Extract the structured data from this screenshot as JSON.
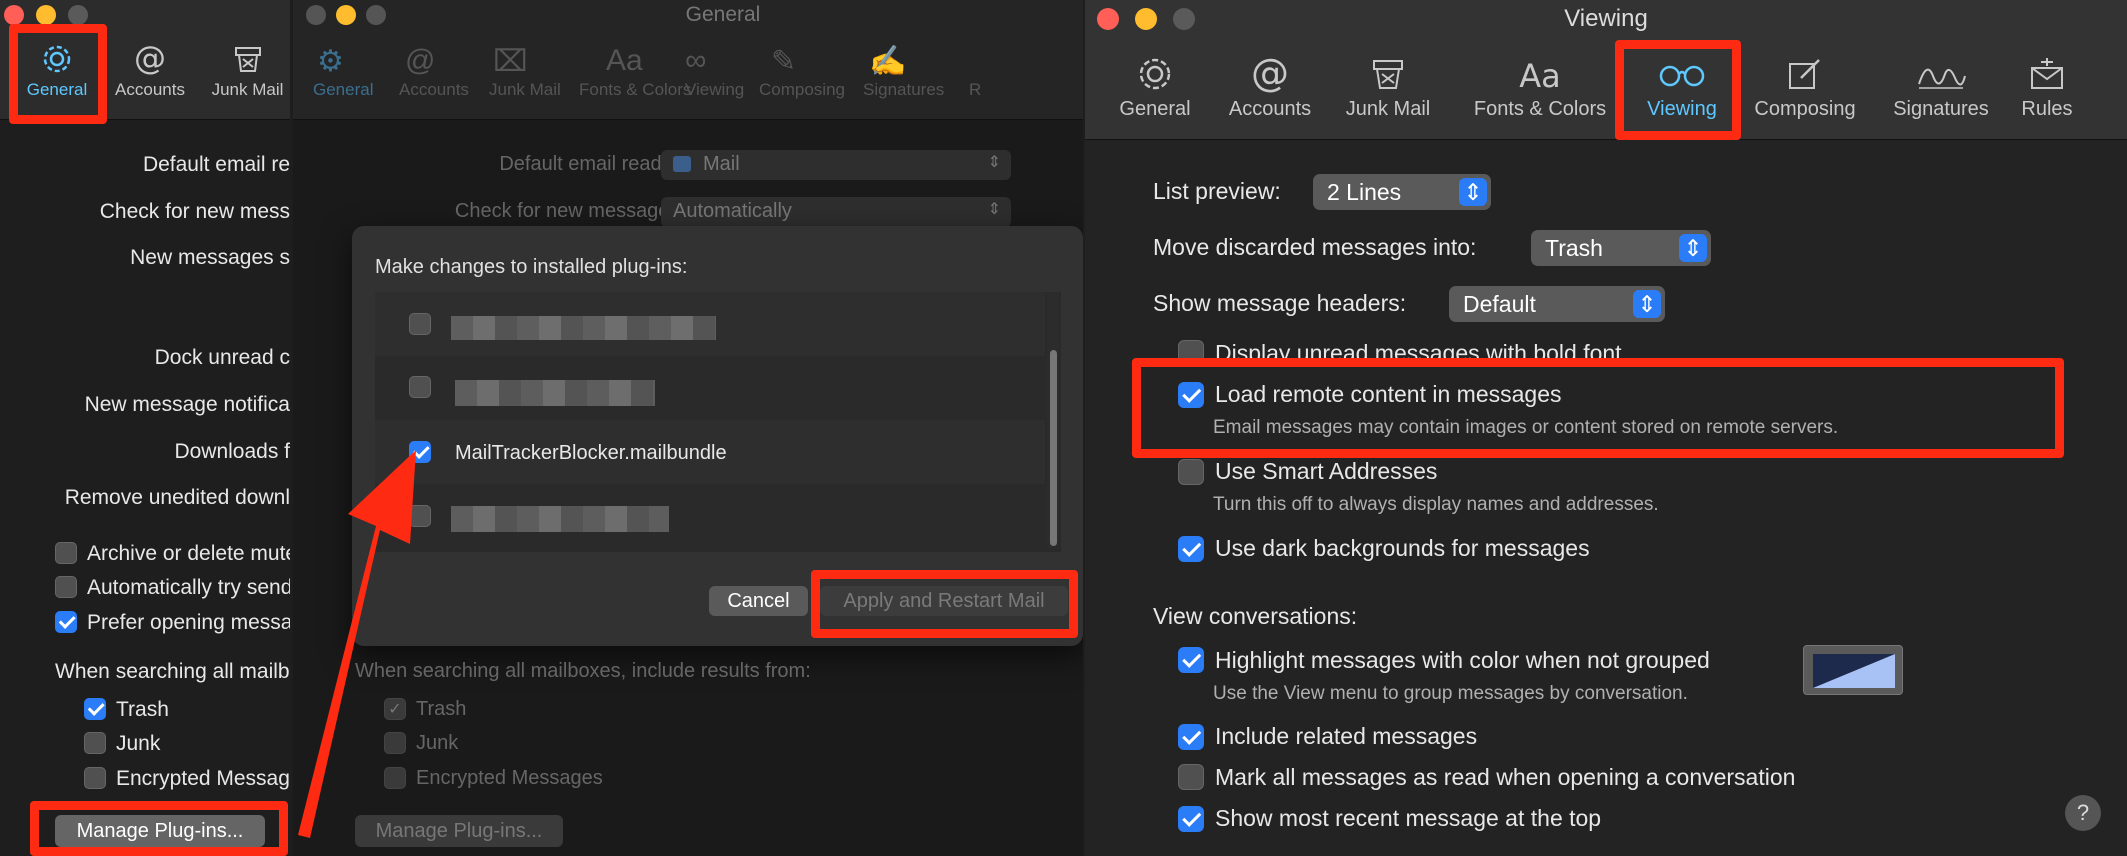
{
  "left": {
    "toolbar": [
      {
        "label": "General",
        "icon": "gear-icon",
        "active": true
      },
      {
        "label": "Accounts",
        "icon": "at-icon"
      },
      {
        "label": "Junk Mail",
        "icon": "junk-icon"
      }
    ],
    "labels": [
      "Default email re",
      "Check for new mess",
      "New messages s",
      "Dock unread c",
      "New message notifica",
      "Downloads f",
      "Remove unedited downl"
    ],
    "checkboxes": [
      {
        "label": "Archive or delete mute",
        "checked": false
      },
      {
        "label": "Automatically try send",
        "checked": false
      },
      {
        "label": "Prefer opening messa",
        "checked": true
      }
    ],
    "search_heading": "When searching all mailbo",
    "search_items": [
      {
        "label": "Trash",
        "checked": true
      },
      {
        "label": "Junk",
        "checked": false
      },
      {
        "label": "Encrypted Message",
        "checked": false
      }
    ],
    "manage_button": "Manage Plug-ins..."
  },
  "middle": {
    "title": "General",
    "toolbar": [
      "General",
      "Accounts",
      "Junk Mail",
      "Fonts & Colors",
      "Viewing",
      "Composing",
      "Signatures",
      "R"
    ],
    "default_reader_label": "Default email reader:",
    "default_reader_value": "Mail",
    "check_label": "Check for new messages:",
    "check_value": "Automatically",
    "dialog": {
      "title": "Make changes to installed plug-ins:",
      "plugins": [
        {
          "name": "",
          "checked": false
        },
        {
          "name": "",
          "checked": false
        },
        {
          "name": "MailTrackerBlocker.mailbundle",
          "checked": true
        },
        {
          "name": "",
          "checked": false
        }
      ],
      "cancel": "Cancel",
      "apply": "Apply and Restart Mail"
    },
    "search_heading": "When searching all mailboxes, include results from:",
    "search_items": [
      {
        "label": "Trash",
        "checked": true
      },
      {
        "label": "Junk",
        "checked": false
      },
      {
        "label": "Encrypted Messages",
        "checked": false
      }
    ],
    "manage_button": "Manage Plug-ins..."
  },
  "right": {
    "title": "Viewing",
    "toolbar": [
      {
        "label": "General",
        "icon": "gear-icon"
      },
      {
        "label": "Accounts",
        "icon": "at-icon"
      },
      {
        "label": "Junk Mail",
        "icon": "junk-icon"
      },
      {
        "label": "Fonts & Colors",
        "icon": "fonts-icon"
      },
      {
        "label": "Viewing",
        "icon": "glasses-icon",
        "active": true
      },
      {
        "label": "Composing",
        "icon": "compose-icon"
      },
      {
        "label": "Signatures",
        "icon": "signature-icon"
      },
      {
        "label": "Rules",
        "icon": "rules-icon"
      }
    ],
    "list_preview_label": "List preview:",
    "list_preview_value": "2 Lines",
    "move_discarded_label": "Move discarded messages into:",
    "move_discarded_value": "Trash",
    "show_headers_label": "Show message headers:",
    "show_headers_value": "Default",
    "options": [
      {
        "label": "Display unread messages with bold font",
        "checked": false,
        "sub": ""
      },
      {
        "label": "Load remote content in messages",
        "checked": true,
        "sub": "Email messages may contain images or content stored on remote servers."
      },
      {
        "label": "Use Smart Addresses",
        "checked": false,
        "sub": "Turn this off to always display names and addresses."
      },
      {
        "label": "Use dark backgrounds for messages",
        "checked": true,
        "sub": ""
      }
    ],
    "view_conversations_label": "View conversations:",
    "conversation_options": [
      {
        "label": "Highlight messages with color when not grouped",
        "checked": true,
        "sub": "Use the View menu to group messages by conversation."
      },
      {
        "label": "Include related messages",
        "checked": true,
        "sub": ""
      },
      {
        "label": "Mark all messages as read when opening a conversation",
        "checked": false,
        "sub": ""
      },
      {
        "label": "Show most recent message at the top",
        "checked": true,
        "sub": ""
      }
    ],
    "help": "?"
  }
}
